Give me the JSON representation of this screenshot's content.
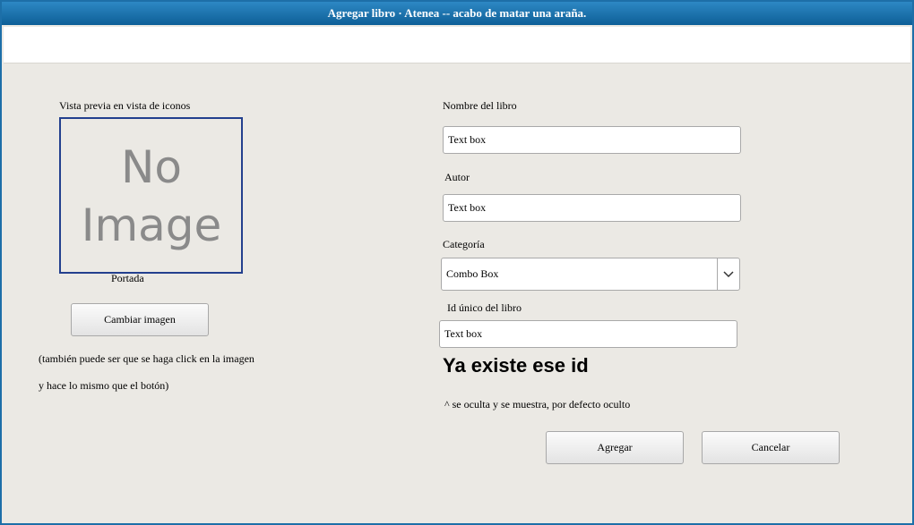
{
  "window": {
    "title": "Agregar libro · Atenea -- acabo de matar una araña."
  },
  "left": {
    "preview_label": "Vista previa en vista de iconos",
    "placeholder_image": {
      "line1": "No",
      "line2": "Image"
    },
    "cover_label": "Portada",
    "change_image_button": "Cambiar imagen",
    "note_line1": "(también puede ser que se haga click en la imagen",
    "note_line2": "y hace lo mismo que el botón)"
  },
  "form": {
    "name_label": "Nombre del libro",
    "name_value": "Text box",
    "author_label": "Autor",
    "author_value": "Text box",
    "category_label": "Categoría",
    "category_value": "Combo Box",
    "id_label": "Id único del libro",
    "id_value": "Text box",
    "id_error": "Ya existe ese id",
    "id_error_note": "^ se oculta y se muestra, por defecto oculto"
  },
  "actions": {
    "add_button": "Agregar",
    "cancel_button": "Cancelar"
  },
  "colors": {
    "titlebar": "#1a74b0",
    "window_bg": "#ebe9e4",
    "preview_border": "#23408e"
  }
}
